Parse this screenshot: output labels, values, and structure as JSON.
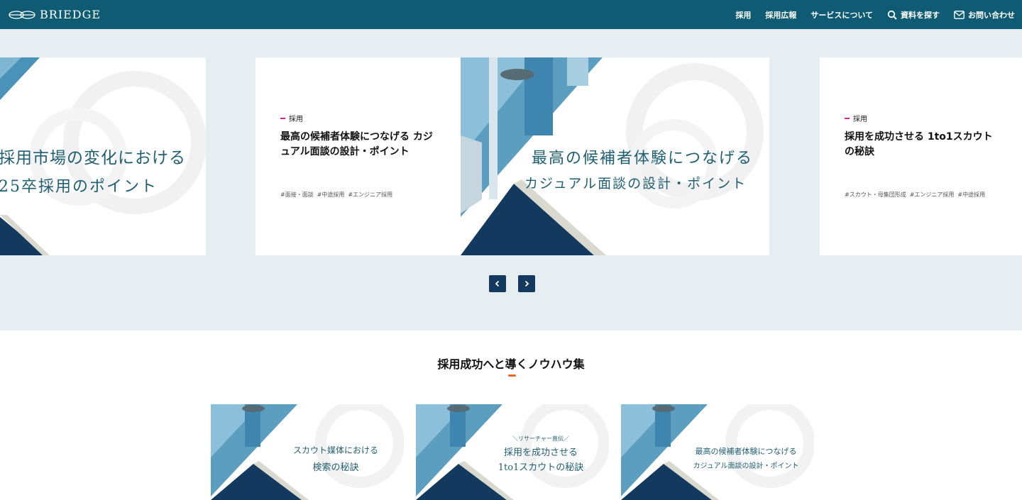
{
  "header": {
    "logo_text": "BRIEDGE",
    "nav": [
      {
        "label": "採用",
        "icon": ""
      },
      {
        "label": "採用広報",
        "icon": ""
      },
      {
        "label": "サービスについて",
        "icon": ""
      },
      {
        "label": "資料を探す",
        "icon": "search-icon"
      },
      {
        "label": "お問い合わせ",
        "icon": "mail-icon"
      }
    ]
  },
  "carousel": {
    "left_card": {
      "caption_line1": "採用市場の変化における",
      "caption_line2": "25卒採用のポイント"
    },
    "main_card": {
      "category": "採用",
      "title": "最高の候補者体験につなげる カジュアル面談の設計・ポイント",
      "tags": [
        "#面接・面談",
        "#中途採用",
        "#エンジニア採用"
      ],
      "banner_line1": "最高の候補者体験につなげる",
      "banner_line2": "カジュアル面談の設計・ポイント"
    },
    "right_card": {
      "category": "採用",
      "title": "採用を成功させる 1to1スカウトの秘訣",
      "tags": [
        "#スカウト・母集団形成",
        "#エンジニア採用",
        "#中途採用"
      ]
    },
    "prev_icon": "chevron-left-icon",
    "next_icon": "chevron-right-icon"
  },
  "knowhow": {
    "title": "採用成功へと導くノウハウ集",
    "items": [
      {
        "line1": "スカウト媒体における",
        "line2": "検索の秘訣",
        "eyebrow": ""
      },
      {
        "line1": "採用を成功させる",
        "line2": "1to1スカウトの秘訣",
        "eyebrow": "＼リサーチャー直伝／"
      },
      {
        "line1": "最高の候補者体験につなげる",
        "line2": "カジュアル面談の設計・ポイント",
        "eyebrow": ""
      }
    ]
  },
  "colors": {
    "header_bg": "#0e5b73",
    "band_bg": "#e7eef1",
    "navy": "#133a5e",
    "accent_pink": "#e0208a",
    "accent_orange": "#e8672a",
    "caption_teal": "#1f5f73"
  }
}
